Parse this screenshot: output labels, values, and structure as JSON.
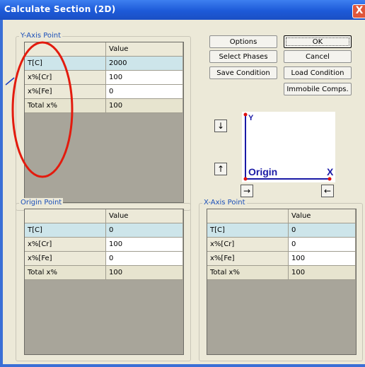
{
  "window": {
    "title": "Calculate Section (2D)",
    "close_glyph": "X"
  },
  "y_axis": {
    "label": "Y-Axis Point",
    "col_header": "Value",
    "rows": [
      {
        "name": "T[C]",
        "value": "2000"
      },
      {
        "name": "x%[Cr]",
        "value": "100"
      },
      {
        "name": "x%[Fe]",
        "value": "0"
      },
      {
        "name": "Total x%",
        "value": "100"
      }
    ]
  },
  "origin": {
    "label": "Origin Point",
    "col_header": "Value",
    "rows": [
      {
        "name": "T[C]",
        "value": "0"
      },
      {
        "name": "x%[Cr]",
        "value": "100"
      },
      {
        "name": "x%[Fe]",
        "value": "0"
      },
      {
        "name": "Total x%",
        "value": "100"
      }
    ]
  },
  "x_axis": {
    "label": "X-Axis Point",
    "col_header": "Value",
    "rows": [
      {
        "name": "T[C]",
        "value": "0"
      },
      {
        "name": "x%[Cr]",
        "value": "0"
      },
      {
        "name": "x%[Fe]",
        "value": "100"
      },
      {
        "name": "Total x%",
        "value": "100"
      }
    ]
  },
  "buttons": {
    "options": "Options",
    "ok": "OK",
    "select_phases": "Select Phases",
    "cancel": "Cancel",
    "save_condition": "Save Condition",
    "load_condition": "Load Condition",
    "immobile": "Immobile Comps."
  },
  "diagram": {
    "y_label": "Y",
    "x_label": "X",
    "origin_label": "Origin",
    "axis_color": "#1a1aa6",
    "point_color": "#e01010"
  },
  "arrows": {
    "down": "↓",
    "up": "↑",
    "right": "→",
    "left": "←"
  },
  "annotation_color": "#e31b0e"
}
